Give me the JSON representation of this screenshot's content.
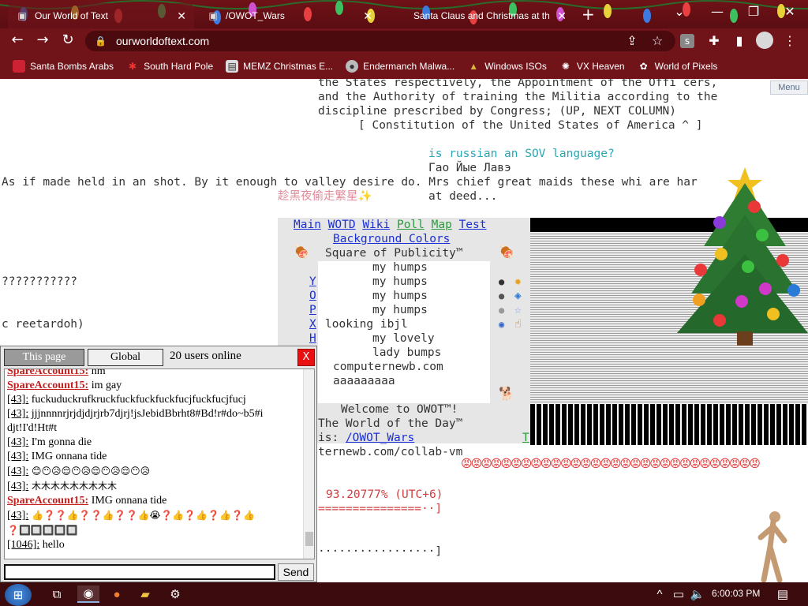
{
  "browser": {
    "tabs": [
      {
        "title": "Our World of Text",
        "active": true
      },
      {
        "title": "/OWOT_Wars",
        "active": false
      },
      {
        "title": "Santa Claus and Christmas at th",
        "active": false
      }
    ],
    "address": "ourworldoftext.com",
    "bookmarks": [
      {
        "label": "Santa Bombs Arabs",
        "icon": "santa-icon"
      },
      {
        "label": "South Hard Pole",
        "icon": "snowflake-icon"
      },
      {
        "label": "MEMZ Christmas E...",
        "icon": "image-icon"
      },
      {
        "label": "Endermanch Malwa...",
        "icon": "paw-icon"
      },
      {
        "label": "Windows ISOs",
        "icon": "tree-icon"
      },
      {
        "label": "VX Heaven",
        "icon": "bug-icon"
      },
      {
        "label": "World of Pixels",
        "icon": "pixels-icon"
      }
    ],
    "accent": "#701419"
  },
  "owot": {
    "menu_label": "Menu",
    "lines": {
      "l1": "the States respectively, the Appointment of the Offi cers,",
      "l2": "and the Authority of training the Militia according to the",
      "l3": "discipline prescribed by Congress; (UP, NEXT COLUMN)",
      "l4": "[ Constitution of the United States of America ^ ]",
      "l5": "is russian an SOV language?",
      "l6": "Гао Йые Лавэ",
      "l7": "As if made held in an shot. By it enough to valley desire do. Mrs chief great maids these whi are har",
      "l8": "趁黑夜偷走繁星✨",
      "l9": "at deed...",
      "q": "???????????",
      "ret": "c reetardoh)",
      "pct": "93.20777% (UTC+6)",
      "eq": "===============··]",
      "dots": "·················]",
      "collab": "ternewb.com/collab-vm"
    },
    "nav_links": [
      "Main",
      "WOTD",
      "Wiki",
      "Poll",
      "Map",
      "Test"
    ],
    "bg_colors": "Background Colors",
    "square_title": "Square of Publicity™",
    "square_lines": [
      "my humps",
      "my humps",
      "my humps",
      "my humps",
      "looking ibjl",
      "my lovely",
      "lady bumps",
      "computernewb.com",
      "aaaaaaaaa"
    ],
    "left_letters": [
      "Y",
      "O",
      "P",
      "X",
      "H"
    ],
    "welcome": "Welcome to OWOT™!",
    "wotd_label": "The World of the Day™",
    "wotd_is": "is:",
    "wotd_link": "/OWOT_Wars",
    "wotd_t": "T"
  },
  "chat": {
    "tab_this_page": "This page",
    "tab_global": "Global",
    "online": "20 users online",
    "close_label": "X",
    "messages": [
      {
        "user": "SpareAccount15:",
        "registered": true,
        "text": " hm"
      },
      {
        "user": "SpareAccount15:",
        "registered": true,
        "text": " im gay"
      },
      {
        "user": "[43]:",
        "registered": false,
        "text": " fuckuduckrufkruckfuckfuckfuckfucjfuckfucjfucj"
      },
      {
        "user": "[43]:",
        "registered": false,
        "text": " jjjnnnnrjrjdjdjrjrb7djrj!jsJebidBbrht8#Bd!r#do~b5#i"
      },
      {
        "user": "",
        "registered": false,
        "text": "djt!I'd!Ht#t"
      },
      {
        "user": "[43]:",
        "registered": false,
        "text": " I'm gonna die"
      },
      {
        "user": "[43]:",
        "registered": false,
        "text": " IMG onnana tide"
      },
      {
        "user": "[43]:",
        "registered": false,
        "text": " 😊😶😥😌😶😥😌😶😥😌😶😥"
      },
      {
        "user": "[43]:",
        "registered": false,
        "text": " 木木木木木木木木木"
      },
      {
        "user": "SpareAccount15:",
        "registered": true,
        "text": " IMG onnana tide"
      },
      {
        "user": "[43]:",
        "registered": false,
        "text": " 👍❓❓👍❓❓👍❓❓👍😭❓👍❓👍❓👍❓👍"
      },
      {
        "user": "",
        "registered": false,
        "text": "❓🔲🔲🔲🔲🔲"
      },
      {
        "user": "[1046]:",
        "registered": false,
        "text": " hello"
      }
    ],
    "send_label": "Send"
  },
  "taskbar": {
    "time": "6:00:03 PM"
  }
}
